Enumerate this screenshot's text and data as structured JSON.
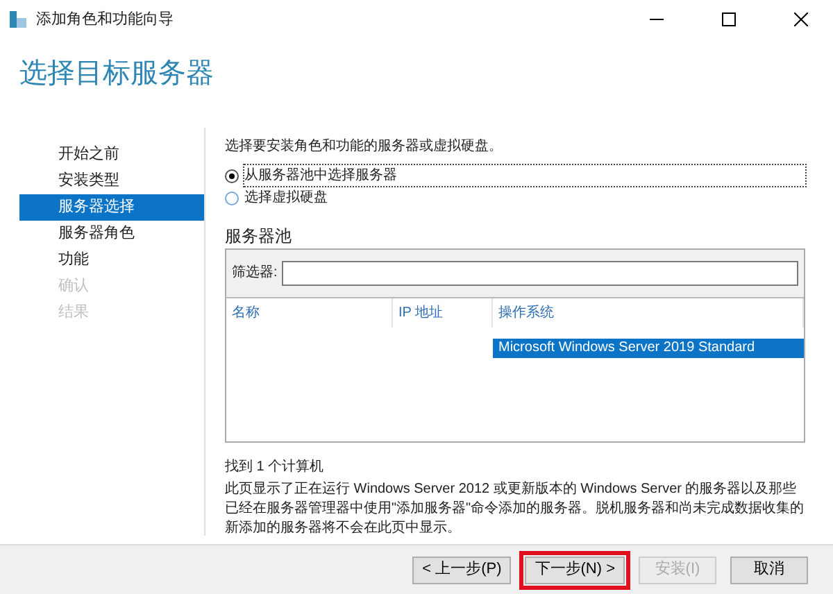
{
  "window": {
    "title": "添加角色和功能向导"
  },
  "heading": "选择目标服务器",
  "steps": [
    {
      "label": "开始之前",
      "selected": false,
      "disabled": false
    },
    {
      "label": "安装类型",
      "selected": false,
      "disabled": false
    },
    {
      "label": "服务器选择",
      "selected": true,
      "disabled": false
    },
    {
      "label": "服务器角色",
      "selected": false,
      "disabled": false
    },
    {
      "label": "功能",
      "selected": false,
      "disabled": false
    },
    {
      "label": "确认",
      "selected": false,
      "disabled": true
    },
    {
      "label": "结果",
      "selected": false,
      "disabled": true
    }
  ],
  "intro": "选择要安装角色和功能的服务器或虚拟硬盘。",
  "options": [
    {
      "label": "从服务器池中选择服务器",
      "selected": true
    },
    {
      "label": "选择虚拟硬盘",
      "selected": false
    }
  ],
  "pool": {
    "title": "服务器池",
    "filter_label": "筛选器:",
    "columns": [
      "名称",
      "IP 地址",
      "操作系统"
    ],
    "rows": [
      {
        "os": "Microsoft Windows Server 2019 Standard",
        "selected": true
      }
    ]
  },
  "count": "找到 1 个计算机",
  "note": "此页显示了正在运行 Windows Server 2012 或更新版本的 Windows Server 的服务器以及那些已经在服务器管理器中使用\"添加服务器\"命令添加的服务器。脱机服务器和尚未完成数据收集的新添加的服务器将不会在此页中显示。",
  "buttons": [
    {
      "label": "< 上一步(P)",
      "disabled": false,
      "highlighted": false
    },
    {
      "label": "下一步(N) >",
      "disabled": false,
      "highlighted": true
    },
    {
      "label": "安装(I)",
      "disabled": true,
      "highlighted": false
    },
    {
      "label": "取消",
      "disabled": false,
      "highlighted": false
    }
  ]
}
